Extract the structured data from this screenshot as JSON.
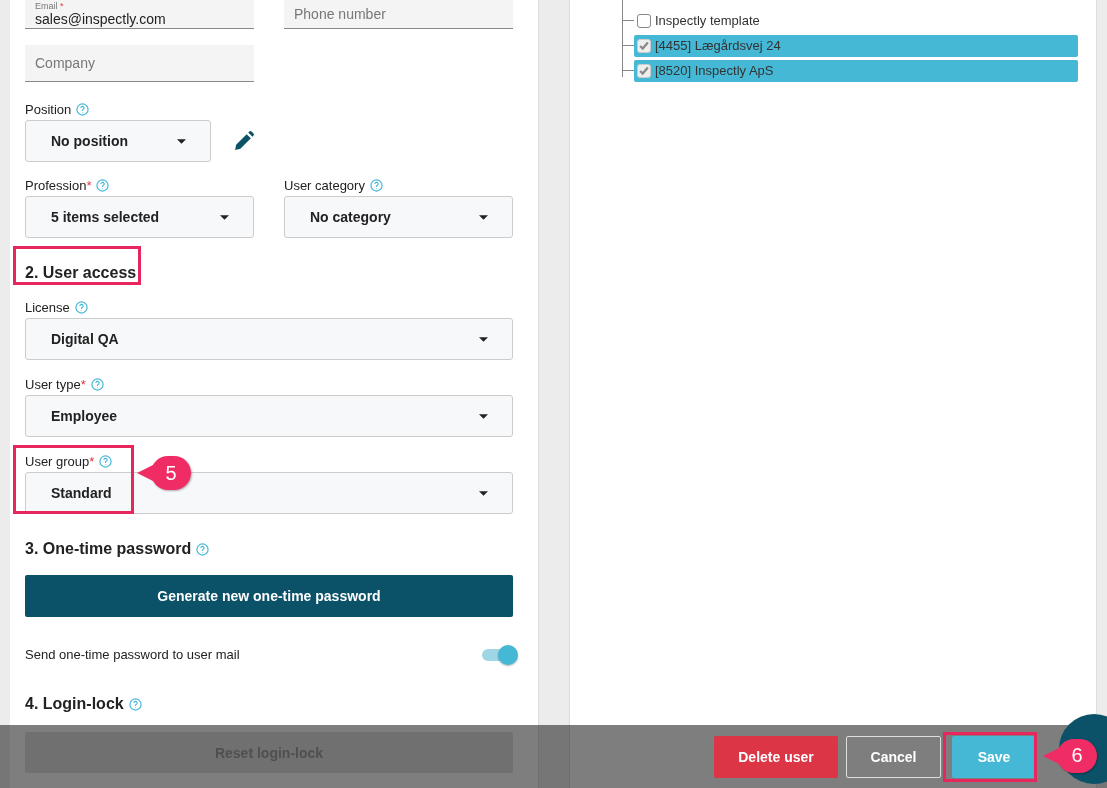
{
  "contact": {
    "email": {
      "label": "Email",
      "required_mark": "*",
      "value": "sales@inspectly.com"
    },
    "phone": {
      "placeholder": "Phone number"
    },
    "company": {
      "placeholder": "Company"
    }
  },
  "position": {
    "label": "Position",
    "value": "No position"
  },
  "profession": {
    "label": "Profession",
    "required_mark": "*",
    "value": "5 items selected"
  },
  "user_category": {
    "label": "User category",
    "value": "No category"
  },
  "user_access": {
    "heading": "2. User access",
    "fields": [
      {
        "label": "License",
        "value": "Digital QA"
      },
      {
        "label": "User type",
        "required_mark": "*",
        "value": "Employee"
      },
      {
        "label": "User group",
        "required_mark": "*",
        "value": "Standard"
      }
    ]
  },
  "one_time_password": {
    "heading": "3. One-time password",
    "button": "Generate new one-time password",
    "send_label": "Send one-time password to user mail",
    "send_on": true
  },
  "login_lock": {
    "heading": "4. Login-lock",
    "button": "Reset login-lock",
    "disabled": true
  },
  "tree": [
    {
      "label": "Inspectly template",
      "checked": false,
      "selected": false
    },
    {
      "label": "[4455] Lægårdsvej 24",
      "checked": true,
      "selected": true
    },
    {
      "label": "[8520] Inspectly ApS",
      "checked": true,
      "selected": true
    }
  ],
  "footer_buttons": [
    {
      "label": "Delete user",
      "kind": "danger"
    },
    {
      "label": "Cancel",
      "kind": "secondary"
    },
    {
      "label": "Save",
      "kind": "primary"
    }
  ],
  "callouts": [
    {
      "label": "5"
    },
    {
      "label": "6"
    }
  ]
}
